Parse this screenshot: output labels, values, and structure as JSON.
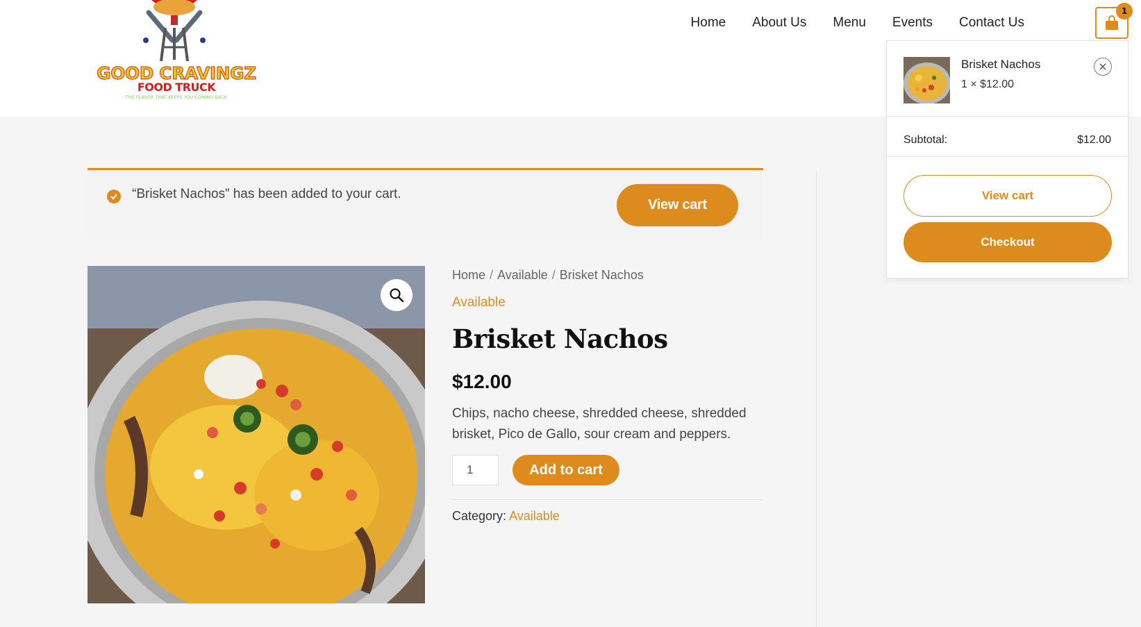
{
  "brand": {
    "title": "GOOD CRAVINGZ",
    "subtitle": "FOOD TRUCK",
    "tagline": "THE FLAVOR THAT KEEPS YOU COMING BACK"
  },
  "nav": {
    "items": [
      "Home",
      "About Us",
      "Menu",
      "Events",
      "Contact Us"
    ],
    "cart_count": "1"
  },
  "notice": {
    "message": "“Brisket Nachos” has been added to your cart.",
    "button": "View cart"
  },
  "product": {
    "breadcrumb": [
      "Home",
      "Available",
      "Brisket Nachos"
    ],
    "category_link": "Available",
    "title": "Brisket Nachos",
    "price": "$12.00",
    "description": "Chips, nacho cheese, shredded cheese, shredded brisket, Pico de Gallo, sour cream and peppers.",
    "quantity": "1",
    "add_to_cart": "Add to cart",
    "meta_label": "Category:",
    "meta_value": "Available"
  },
  "minicart": {
    "item_name": "Brisket Nachos",
    "item_qty": "1 × $12.00",
    "subtotal_label": "Subtotal:",
    "subtotal_value": "$12.00",
    "view_cart": "View cart",
    "checkout": "Checkout"
  },
  "colors": {
    "accent": "#de8b1e",
    "page_bg": "#f5f5f5",
    "header_bg": "#ffffff"
  }
}
